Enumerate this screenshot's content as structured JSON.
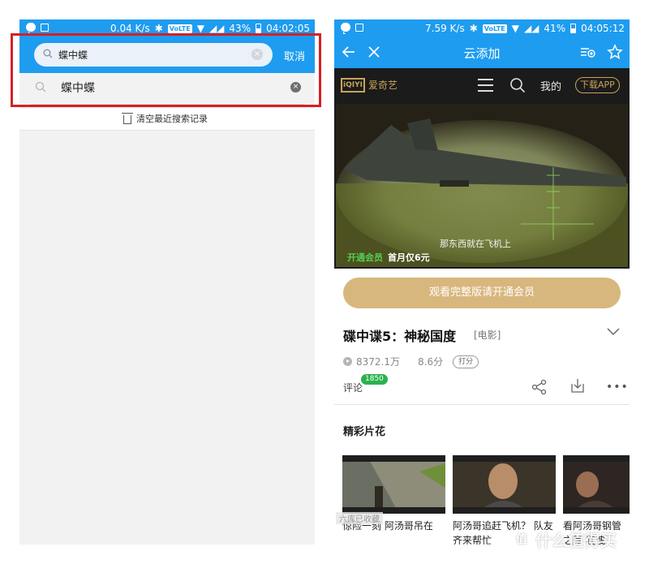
{
  "left_phone": {
    "status_bar": {
      "net_speed": "0.04 K/s",
      "volte": "VoLTE",
      "battery": "43%",
      "time": "04:02:05"
    },
    "search": {
      "query": "蝶中蝶",
      "clear_glyph": "×",
      "cancel_label": "取消"
    },
    "suggestions": [
      {
        "label": "蝶中蝶",
        "remove_glyph": "×"
      }
    ],
    "clear_history_label": "清空最近搜索记录",
    "highlight_color": "#d62024"
  },
  "right_phone": {
    "status_bar": {
      "net_speed": "7.59 K/s",
      "volte": "VoLTE",
      "battery": "41%",
      "time": "04:05:12"
    },
    "header_title": "云添加",
    "site_bar": {
      "logo_text": "iQIYI",
      "brand": "爱奇艺",
      "mine_label": "我的",
      "download_app_label": "下载APP"
    },
    "video": {
      "subtitle": "那东西就在飞机上",
      "promo_vip": "开通会员",
      "promo_price": "首月仅6元"
    },
    "watch_full_button": "观看完整版请开通会员",
    "movie": {
      "title": "碟中谍5：神秘国度",
      "type": "[电影]",
      "plays": "8372.1万",
      "score": "8.6分",
      "rate_label": "打分",
      "comment_label": "评论",
      "comment_count": "1850",
      "more_glyph": "•••"
    },
    "section_title": "精彩片花",
    "clips": [
      {
        "caption": "惊险一刻 阿汤哥吊在"
      },
      {
        "caption": "阿汤哥追赶飞机？ 队友齐来帮忙"
      },
      {
        "caption": "看阿汤哥钢管 之舞 狂拽"
      }
    ],
    "clip_overlay_tag": "六库已收藏",
    "accent_color": "#1e9cf0",
    "gold_color": "#d8b77e"
  },
  "watermark": {
    "logo_glyph": "值",
    "text": "什么值得买"
  }
}
